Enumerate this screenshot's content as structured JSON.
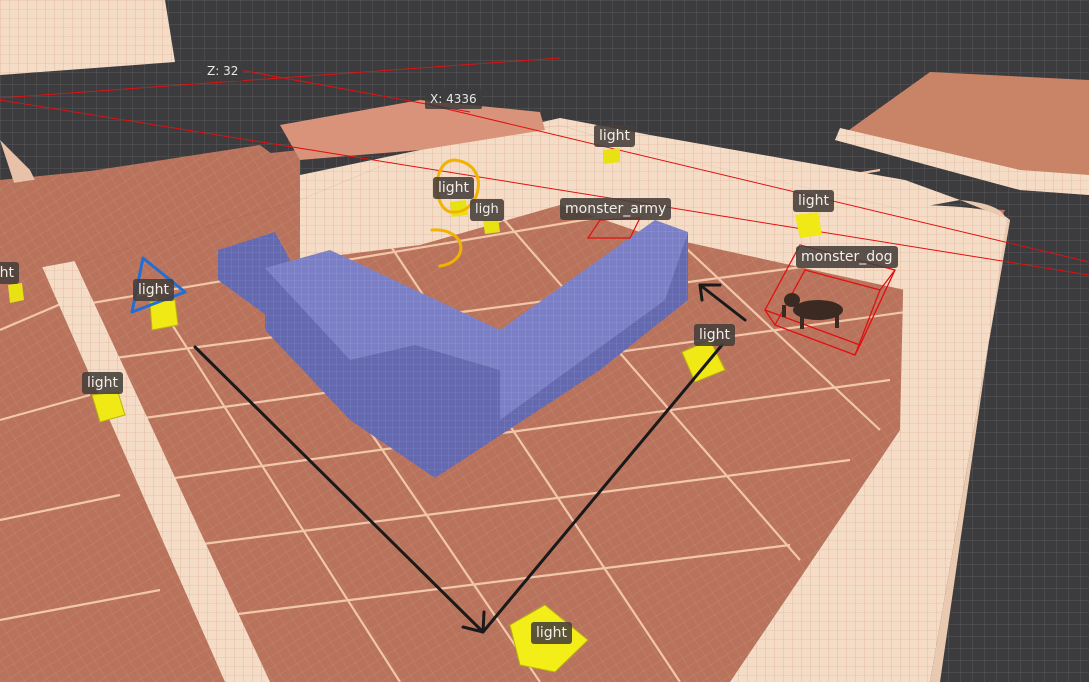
{
  "editor": {
    "axis_readouts": {
      "z": "Z: 32",
      "x": "X: 4336"
    },
    "entities": [
      {
        "label": "light",
        "kind": "light"
      },
      {
        "label": "light",
        "kind": "light"
      },
      {
        "label": "light",
        "kind": "light"
      },
      {
        "label": "light",
        "kind": "light"
      },
      {
        "label": "light",
        "kind": "light"
      },
      {
        "label": "light",
        "kind": "light"
      },
      {
        "label": "light",
        "kind": "light"
      },
      {
        "label": "ligh",
        "kind": "light"
      },
      {
        "label": "light",
        "kind": "light"
      },
      {
        "label": "monster_army",
        "kind": "monster"
      },
      {
        "label": "monster_dog",
        "kind": "monster"
      }
    ],
    "colors": {
      "void": "#3a3a3c",
      "floor": "#b9735c",
      "wall": "#f5dcc6",
      "brush_block": "#7f83c8",
      "light_entity": "#f1ee1c",
      "monster_bbox": "#e01010",
      "annotation_arrow": "#1a1a1a",
      "annotation_yellow": "#f0b400",
      "annotation_blue": "#1f6fd6"
    },
    "annotations": [
      {
        "kind": "arrow",
        "description": "down-right then up-right path"
      },
      {
        "kind": "circle",
        "color": "annotation_yellow"
      },
      {
        "kind": "triangle",
        "color": "annotation_blue"
      }
    ]
  }
}
